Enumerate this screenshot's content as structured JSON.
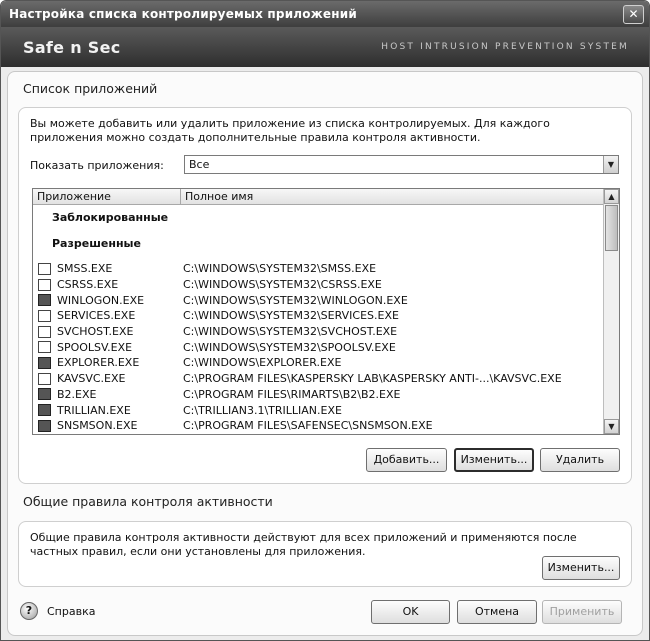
{
  "window": {
    "title": "Настройка списка контролируемых приложений",
    "close_symbol": "✕"
  },
  "brand": {
    "logo": "Safe n Sec",
    "subtitle": "HOST INTRUSION PREVENTION SYSTEM"
  },
  "app_list_section": {
    "title": "Список приложений",
    "description": "Вы можете добавить или удалить приложение из списка контролируемых. Для каждого приложения можно создать дополнительные правила контроля активности.",
    "show_label": "Показать приложения:",
    "show_value": "Все",
    "columns": [
      "Приложение",
      "Полное имя"
    ],
    "groups": {
      "blocked": "Заблокированные",
      "allowed": "Разрешенные"
    },
    "rows": [
      {
        "name": "SMSS.EXE",
        "path": "C:\\WINDOWS\\SYSTEM32\\SMSS.EXE",
        "icon": "window-icon"
      },
      {
        "name": "CSRSS.EXE",
        "path": "C:\\WINDOWS\\SYSTEM32\\CSRSS.EXE",
        "icon": "window-icon"
      },
      {
        "name": "WINLOGON.EXE",
        "path": "C:\\WINDOWS\\SYSTEM32\\WINLOGON.EXE",
        "icon": "lock-icon"
      },
      {
        "name": "SERVICES.EXE",
        "path": "C:\\WINDOWS\\SYSTEM32\\SERVICES.EXE",
        "icon": "window-icon"
      },
      {
        "name": "SVCHOST.EXE",
        "path": "C:\\WINDOWS\\SYSTEM32\\SVCHOST.EXE",
        "icon": "window-icon"
      },
      {
        "name": "SPOOLSV.EXE",
        "path": "C:\\WINDOWS\\SYSTEM32\\SPOOLSV.EXE",
        "icon": "window-icon"
      },
      {
        "name": "EXPLORER.EXE",
        "path": "C:\\WINDOWS\\EXPLORER.EXE",
        "icon": "explorer-icon"
      },
      {
        "name": "KAVSVC.EXE",
        "path": "C:\\PROGRAM FILES\\KASPERSKY LAB\\KASPERSKY ANTI-...\\KAVSVC.EXE",
        "icon": "window-icon"
      },
      {
        "name": "B2.EXE",
        "path": "C:\\PROGRAM FILES\\RIMARTS\\B2\\B2.EXE",
        "icon": "mail-icon"
      },
      {
        "name": "TRILLIAN.EXE",
        "path": "C:\\TRILLIAN3.1\\TRILLIAN.EXE",
        "icon": "trillian-icon"
      },
      {
        "name": "SNSMSON.EXE",
        "path": "C:\\PROGRAM FILES\\SAFENSEC\\SNSMSON.EXE",
        "icon": "app-icon"
      }
    ],
    "buttons": {
      "add": "Добавить...",
      "edit": "Изменить...",
      "delete": "Удалить"
    }
  },
  "rules_section": {
    "title": "Общие правила контроля активности",
    "description": "Общие правила контроля активности действуют для всех приложений и применяются после частных правил, если они установлены для приложения.",
    "edit_button": "Изменить..."
  },
  "footer": {
    "help": "Справка",
    "help_icon_glyph": "?",
    "ok": "OK",
    "cancel": "Отмена",
    "apply": "Применить"
  },
  "scrollbar": {
    "up": "▲",
    "down": "▼"
  },
  "dropdown_arrow": "▼"
}
